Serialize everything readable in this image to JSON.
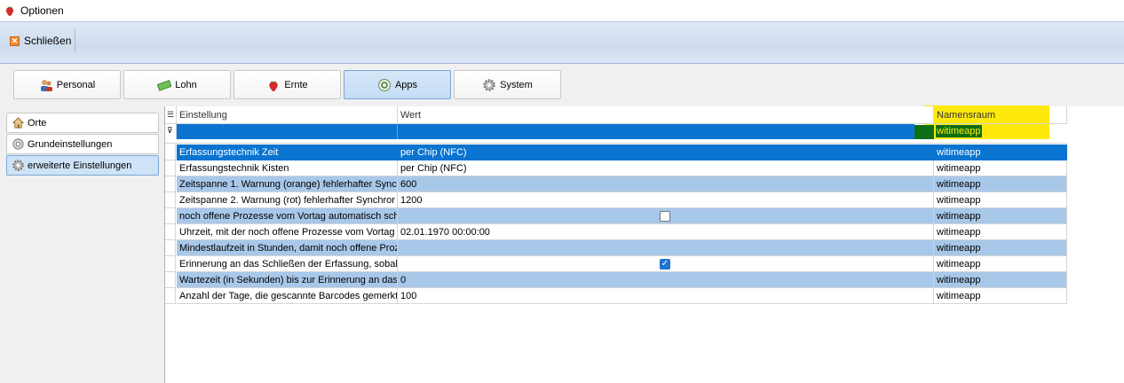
{
  "window": {
    "title": "Optionen"
  },
  "toolbar": {
    "close_label": "Schließen"
  },
  "categories": [
    {
      "label": "Personal",
      "icon": "people-icon"
    },
    {
      "label": "Lohn",
      "icon": "money-icon"
    },
    {
      "label": "Ernte",
      "icon": "strawberry-icon"
    },
    {
      "label": "Apps",
      "icon": "app-icon",
      "active": true
    },
    {
      "label": "System",
      "icon": "gear-icon"
    }
  ],
  "sidenav": [
    {
      "label": "Orte",
      "icon": "house-icon"
    },
    {
      "label": "Grundeinstellungen",
      "icon": "settings-list-icon"
    },
    {
      "label": "erweiterte Einstellungen",
      "icon": "gear-icon",
      "active": true
    }
  ],
  "grid": {
    "columns": [
      "Einstellung",
      "Wert",
      "Namensraum"
    ],
    "filter": {
      "namensraum": "witimeapp"
    },
    "rows": [
      {
        "einstellung": "Erfassungstechnik Zeit",
        "wert": "per Chip (NFC)",
        "namensraum": "witimeapp",
        "style": "selected"
      },
      {
        "einstellung": "Erfassungstechnik Kisten",
        "wert": "per Chip (NFC)",
        "namensraum": "witimeapp",
        "style": "white"
      },
      {
        "einstellung": "Zeitspanne 1. Warnung (orange) fehlerhafter Sync",
        "wert": "600",
        "namensraum": "witimeapp",
        "style": "alt"
      },
      {
        "einstellung": "Zeitspanne 2. Warnung (rot) fehlerhafter Synchror",
        "wert": "1200",
        "namensraum": "witimeapp",
        "style": "white"
      },
      {
        "einstellung": "noch offene Prozesse vom Vortag automatisch schli",
        "wert": "",
        "checkbox": false,
        "namensraum": "witimeapp",
        "style": "alt"
      },
      {
        "einstellung": "Uhrzeit, mit der noch offene Prozesse vom Vortag a",
        "wert": "02.01.1970 00:00:00",
        "namensraum": "witimeapp",
        "style": "white"
      },
      {
        "einstellung": "Mindestlaufzeit in Stunden, damit noch offene Proze",
        "wert": "",
        "namensraum": "witimeapp",
        "style": "alt"
      },
      {
        "einstellung": "Erinnerung an das Schließen der Erfassung, sobald",
        "wert": "",
        "checkbox": true,
        "namensraum": "witimeapp",
        "style": "white"
      },
      {
        "einstellung": "Wartezeit (in Sekunden) bis zur Erinnerung an das S",
        "wert": "0",
        "namensraum": "witimeapp",
        "style": "alt"
      },
      {
        "einstellung": "Anzahl der Tage, die gescannte Barcodes gemerkt",
        "wert": "100",
        "namensraum": "witimeapp",
        "style": "white"
      }
    ]
  },
  "colors": {
    "selection": "#0a74d0",
    "alt_row": "#a8c8ea",
    "highlight": "#ffe800",
    "active_category": "#c3dcf5"
  }
}
